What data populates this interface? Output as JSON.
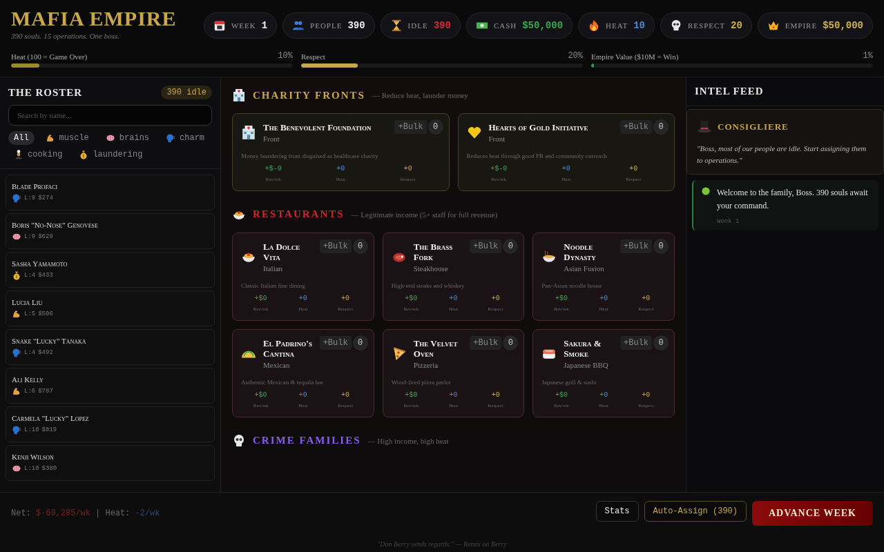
{
  "header": {
    "title": "MAFIA EMPIRE",
    "subtitle": "390 souls. 15 operations. One boss.",
    "stats": [
      {
        "label": "WEEK",
        "value": "1",
        "color": "#eeeeee"
      },
      {
        "label": "PEOPLE",
        "value": "390",
        "color": "#eeeeee"
      },
      {
        "label": "IDLE",
        "value": "390",
        "color": "#d03030"
      },
      {
        "label": "CASH",
        "value": "$50,000",
        "color": "#3aa655"
      },
      {
        "label": "HEAT",
        "value": "10",
        "color": "#4a8ad8"
      },
      {
        "label": "RESPECT",
        "value": "20",
        "color": "#d4b24c"
      },
      {
        "label": "EMPIRE",
        "value": "$50,000",
        "color": "#d4b24c"
      }
    ],
    "meters": [
      {
        "label": "Heat (100 = Game Over)",
        "reading": "10%",
        "level": 0.1,
        "color": "#9a8a2a"
      },
      {
        "label": "Respect",
        "reading": "20%",
        "level": 0.2,
        "color": "#c9a84c"
      },
      {
        "label": "Empire Value ($10M = Win)",
        "reading": "1%",
        "level": 0.01,
        "color": "#2e9d4a"
      }
    ]
  },
  "roster": {
    "title": "THE ROSTER",
    "badge": "390 idle",
    "search": {
      "placeholder": "Search by name..."
    },
    "filters": [
      {
        "label": "All",
        "kind": "all",
        "selected": true
      },
      {
        "label": "muscle",
        "kind": "muscle",
        "selected": false
      },
      {
        "label": "brains",
        "kind": "brains",
        "selected": false
      },
      {
        "label": "charm",
        "kind": "charm",
        "selected": false
      },
      {
        "label": "cooking",
        "kind": "cooking",
        "selected": false
      },
      {
        "label": "laundering",
        "kind": "laundering",
        "selected": false
      }
    ],
    "members": [
      {
        "name": "Blade Profaci",
        "kind": "charm",
        "level": "L:9",
        "wage": "$274"
      },
      {
        "name": "Boris \"No-Nose\" Genovese",
        "kind": "brains",
        "level": "L:9",
        "wage": "$629"
      },
      {
        "name": "Sasha Yamamoto",
        "kind": "laundering",
        "level": "L:4",
        "wage": "$433"
      },
      {
        "name": "Lucia Liu",
        "kind": "muscle",
        "level": "L:5",
        "wage": "$506"
      },
      {
        "name": "Snake \"Lucky\" Tanaka",
        "kind": "charm",
        "level": "L:4",
        "wage": "$492"
      },
      {
        "name": "Ali Kelly",
        "kind": "muscle",
        "level": "L:6",
        "wage": "$787"
      },
      {
        "name": "Carmela \"Lucky\" Lopez",
        "kind": "charm",
        "level": "L:10",
        "wage": "$819"
      },
      {
        "name": "Kenji Wilson",
        "kind": "brains",
        "level": "L:10",
        "wage": "$380"
      }
    ]
  },
  "sections": [
    {
      "kind": "charity",
      "title": "CHARITY FRONTS",
      "subtitle": "— Reduce heat, launder money",
      "color": "#c9a84c",
      "cards": [
        {
          "name": "The Benevolent Foundation",
          "type": "Front",
          "description": "Money laundering front disguised as healthcare charity",
          "revenue": "+$-0",
          "revenue_label": "Rev/wk",
          "heat": "+0",
          "heat_label": "Heat",
          "respect": "+0",
          "respect_label": "Respect",
          "bulk": "+Bulk",
          "count": "0"
        },
        {
          "name": "Hearts of Gold Initiative",
          "type": "Front",
          "description": "Reduces heat through good PR and community outreach",
          "revenue": "+$-0",
          "revenue_label": "Rev/wk",
          "heat": "+0",
          "heat_label": "Heat",
          "respect": "+0",
          "respect_label": "Respect",
          "bulk": "+Bulk",
          "count": "0"
        }
      ]
    },
    {
      "kind": "restaurant",
      "title": "RESTAURANTS",
      "subtitle": "— Legitimate income (5+ staff for full revenue)",
      "color": "#c8282e",
      "cards": [
        {
          "name": "La Dolce Vita",
          "type": "Italian",
          "description": "Classic Italian fine dining",
          "revenue": "+$0",
          "revenue_label": "Rev/wk",
          "heat": "+0",
          "heat_label": "Heat",
          "respect": "+0",
          "respect_label": "Respect",
          "bulk": "+Bulk",
          "count": "0"
        },
        {
          "name": "The Brass Fork",
          "type": "Steakhouse",
          "description": "High-end steaks and whiskey",
          "revenue": "+$0",
          "revenue_label": "Rev/wk",
          "heat": "+0",
          "heat_label": "Heat",
          "respect": "+0",
          "respect_label": "Respect",
          "bulk": "+Bulk",
          "count": "0"
        },
        {
          "name": "Noodle Dynasty",
          "type": "Asian Fusion",
          "description": "Pan-Asian noodle house",
          "revenue": "+$0",
          "revenue_label": "Rev/wk",
          "heat": "+0",
          "heat_label": "Heat",
          "respect": "+0",
          "respect_label": "Respect",
          "bulk": "+Bulk",
          "count": "0"
        },
        {
          "name": "El Padrino's Cantina",
          "type": "Mexican",
          "description": "Authentic Mexican & tequila bar",
          "revenue": "+$0",
          "revenue_label": "Rev/wk",
          "heat": "+0",
          "heat_label": "Heat",
          "respect": "+0",
          "respect_label": "Respect",
          "bulk": "+Bulk",
          "count": "0"
        },
        {
          "name": "The Velvet Oven",
          "type": "Pizzeria",
          "description": "Wood-fired pizza parlor",
          "revenue": "+$0",
          "revenue_label": "Rev/wk",
          "heat": "+0",
          "heat_label": "Heat",
          "respect": "+0",
          "respect_label": "Respect",
          "bulk": "+Bulk",
          "count": "0"
        },
        {
          "name": "Sakura & Smoke",
          "type": "Japanese BBQ",
          "description": "Japanese grill & sushi",
          "revenue": "+$0",
          "revenue_label": "Rev/wk",
          "heat": "+0",
          "heat_label": "Heat",
          "respect": "+0",
          "respect_label": "Respect",
          "bulk": "+Bulk",
          "count": "0"
        }
      ]
    },
    {
      "kind": "crime",
      "title": "CRIME FAMILIES",
      "subtitle": "— High income, high heat",
      "color": "#8a5cf0"
    }
  ],
  "intel": {
    "title": "INTEL FEED",
    "advisor": {
      "title": "CONSIGLIERE",
      "quote": "\"Boss, most of our people are idle. Start assigning them to operations.\""
    },
    "entries": [
      {
        "text": "Welcome to the family, Boss. 390 souls await your command.",
        "week": "Week 1"
      }
    ]
  },
  "footer": {
    "net_label": "Net:",
    "net": "$-69,285/wk",
    "heat_label": "| Heat:",
    "heat": "-2/wk",
    "buttons": [
      "Stats",
      "Auto-Assign (390)",
      "ADVANCE WEEK"
    ]
  },
  "credit": "\"Don Berry sends regards.\" — Remix on Berry"
}
